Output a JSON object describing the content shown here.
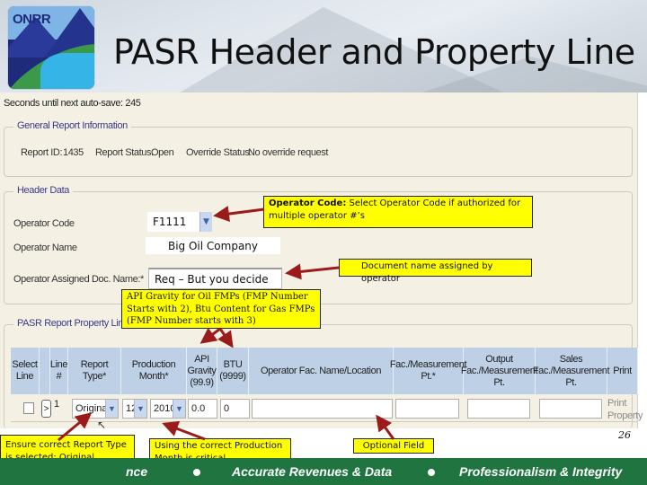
{
  "slide": {
    "title": "PASR Header and Property Line",
    "logo_text": "ONRR",
    "slide_number": "26",
    "footer": {
      "items": [
        "nce",
        "Accurate Revenues & Data",
        "Professionalism & Integrity"
      ]
    }
  },
  "app": {
    "autosave_text": "Seconds until next auto-save: 245",
    "general_info": {
      "legend": "General Report Information",
      "report_id_label": "Report ID:",
      "report_id_value": "1435",
      "report_status_label": "Report Status:",
      "report_status_value": "Open",
      "override_status_label": "Override Status:",
      "override_status_value": "No override request"
    },
    "header_data": {
      "legend": "Header Data",
      "operator_code_label": "Operator Code",
      "operator_code_value": "F1111",
      "operator_name_label": "Operator Name",
      "operator_name_value": "Big Oil Company",
      "doc_name_label": "Operator Assigned Doc. Name:*",
      "doc_name_value": "Req – But you decide"
    },
    "property_lines": {
      "legend": "PASR Report Property Lines",
      "columns": [
        "Select Line",
        "",
        "Line #",
        "Report Type*",
        "Production Month*",
        "API Gravity (99.9)",
        "BTU (9999)",
        "Operator Fac. Name/Location",
        "Fac./Measurement Pt.*",
        "Output Fac./Measurement Pt.",
        "Sales Fac./Measurement Pt.",
        "Print"
      ],
      "rows": [
        {
          "expander": ">",
          "line_no": "1",
          "report_type": "Original",
          "month": "12",
          "year": "2010",
          "api_gravity": "0.0",
          "btu": "0",
          "operator_fac_name": "",
          "fac_measurement_pt": "",
          "output_fac": "",
          "sales_fac": "",
          "print_link": "Print Property"
        }
      ]
    }
  },
  "callouts": {
    "operator_code_bold": "Operator Code:",
    "operator_code_text": " Select Operator Code if authorized for multiple operator #’s",
    "doc_name": "Document name assigned by operator",
    "api_btu": "API Gravity for Oil FMPs (FMP Number Starts with 2), Btu Content for Gas FMPs (FMP Number starts with 3)",
    "report_type": "Ensure correct Report Type is selected:  Original, Modify or Replace",
    "production_month": "Using the correct Production Month is critical",
    "optional_field": "Optional Field"
  },
  "colors": {
    "callout": "#ffff00",
    "arrow": "#9b1b1b",
    "footer": "#1f7440",
    "table_header": "#bdd0e6",
    "form_bg": "#f4f1e4"
  }
}
